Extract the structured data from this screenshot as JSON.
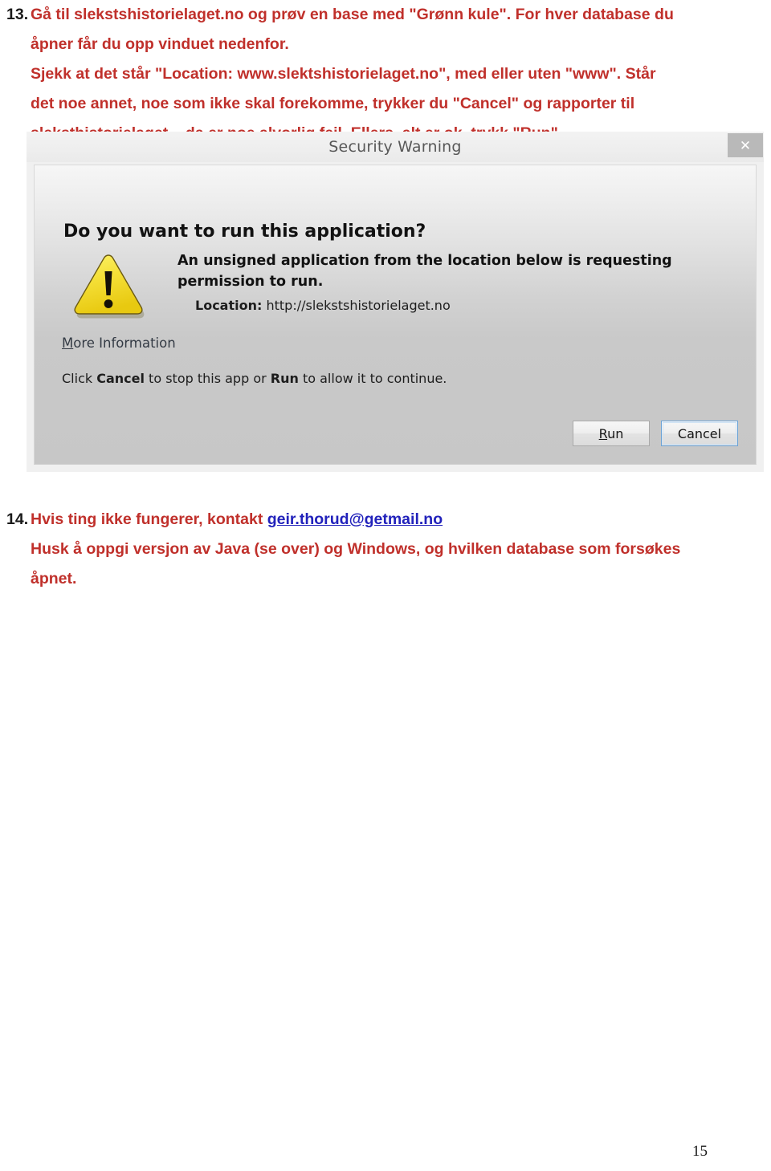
{
  "document": {
    "steps": [
      {
        "number": "13.",
        "lines": [
          "Gå til slekstshistorielaget.no og prøv en base med \"Grønn kule\". For hver database du",
          "åpner får du opp vinduet nedenfor.",
          "Sjekk at det står \"Location: www.slektshistorielaget.no\", med eller uten \"www\". Står",
          "det noe annet, noe som ikke skal forekomme, trykker du \"Cancel\" og rapporter til",
          "sleksthistorielaget – da er noe alvorlig feil. Ellers, alt er ok, trykk \"Run\"."
        ]
      },
      {
        "number": "14.",
        "line_prefix": "Hvis ting ikke fungerer, kontakt ",
        "email": "geir.thorud@getmail.no",
        "lines_after": [
          "Husk å oppgi versjon av Java (se over) og Windows, og hvilken database som forsøkes",
          "åpnet."
        ]
      }
    ],
    "page_number": "15"
  },
  "dialog": {
    "title": "Security Warning",
    "close_label": "✕",
    "heading": "Do you want to run this application?",
    "main_text": "An unsigned application from the location below is requesting permission to run.",
    "location_label": "Location:",
    "location_value": "http://slekstshistorielaget.no",
    "more_information": "More Information",
    "hint": {
      "part1": "Click ",
      "bold1": "Cancel",
      "part2": " to stop this app or ",
      "bold2": "Run",
      "part3": " to allow it to continue."
    },
    "buttons": {
      "run_mnemonic": "R",
      "run_rest": "un",
      "cancel": "Cancel"
    },
    "icon": "warning-triangle-icon"
  },
  "colors": {
    "instruction_red": "#c0302b",
    "link_blue": "#2222bb",
    "warning_yellow": "#f2dc2a",
    "dialog_gray": "#c7c7c7"
  }
}
